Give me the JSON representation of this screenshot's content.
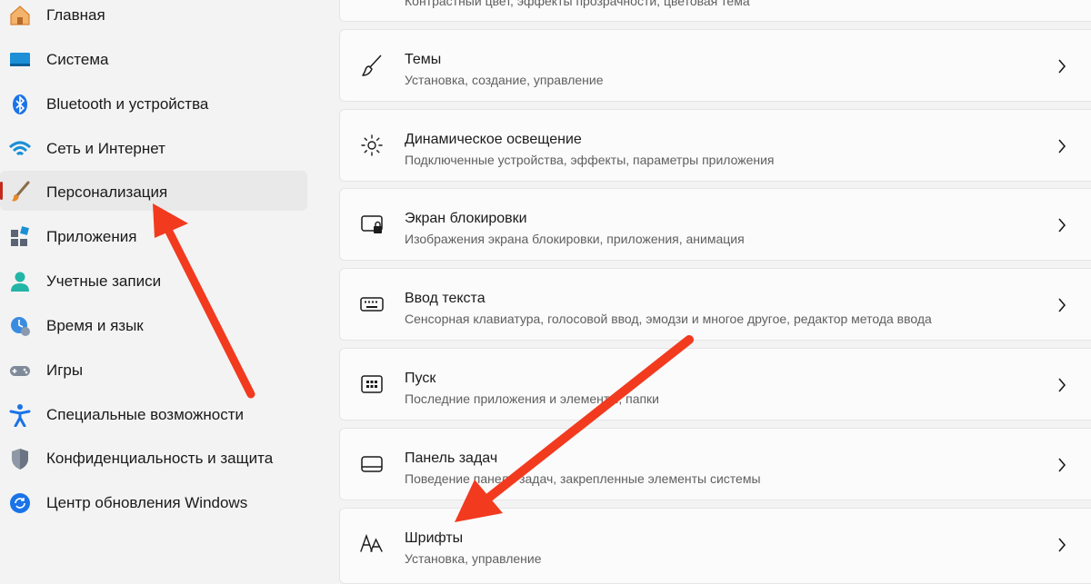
{
  "sidebar": {
    "items": [
      {
        "label": "Главная",
        "icon": "home-icon"
      },
      {
        "label": "Система",
        "icon": "system-icon"
      },
      {
        "label": "Bluetooth и устройства",
        "icon": "bluetooth-icon"
      },
      {
        "label": "Сеть и Интернет",
        "icon": "wifi-icon"
      },
      {
        "label": "Персонализация",
        "icon": "brush-icon",
        "selected": true
      },
      {
        "label": "Приложения",
        "icon": "apps-icon"
      },
      {
        "label": "Учетные записи",
        "icon": "account-icon"
      },
      {
        "label": "Время и язык",
        "icon": "time-language-icon"
      },
      {
        "label": "Игры",
        "icon": "gamepad-icon"
      },
      {
        "label": "Специальные возможности",
        "icon": "accessibility-icon"
      },
      {
        "label": "Конфиденциальность и защита",
        "icon": "shield-icon"
      },
      {
        "label": "Центр обновления Windows",
        "icon": "update-icon"
      }
    ]
  },
  "main": {
    "top_partial_subtitle": "Контрастный цвет, эффекты прозрачности, цветовая тема",
    "cards": [
      {
        "title": "Темы",
        "subtitle": "Установка, создание, управление",
        "icon": "brush-icon"
      },
      {
        "title": "Динамическое освещение",
        "subtitle": "Подключенные устройства, эффекты, параметры приложения",
        "icon": "dynamic-lighting-icon"
      },
      {
        "title": "Экран блокировки",
        "subtitle": "Изображения экрана блокировки, приложения, анимация",
        "icon": "lock-screen-icon"
      },
      {
        "title": "Ввод текста",
        "subtitle": "Сенсорная клавиатура, голосовой ввод, эмодзи и многое другое, редактор метода ввода",
        "icon": "keyboard-icon"
      },
      {
        "title": "Пуск",
        "subtitle": "Последние приложения и элементы, папки",
        "icon": "start-icon"
      },
      {
        "title": "Панель задач",
        "subtitle": "Поведение панели задач, закрепленные элементы системы",
        "icon": "taskbar-icon"
      },
      {
        "title": "Шрифты",
        "subtitle": "Установка, управление",
        "icon": "fonts-icon"
      }
    ]
  },
  "colors": {
    "accent": "#0067c0",
    "selection_bar": "#c42b1c",
    "annotation_arrow": "#f23a1f"
  }
}
